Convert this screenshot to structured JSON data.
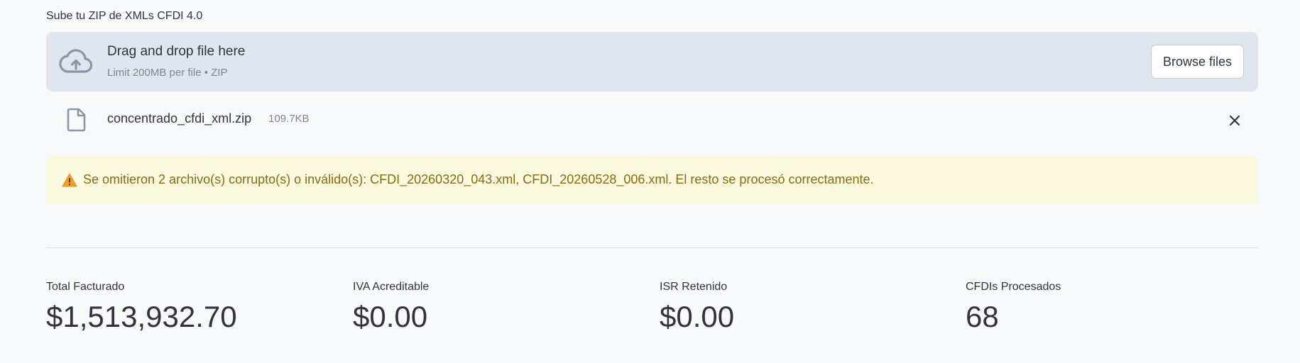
{
  "uploader": {
    "label": "Sube tu ZIP de XMLs CFDI 4.0",
    "drop_title": "Drag and drop file here",
    "drop_subtitle": "Limit 200MB per file • ZIP",
    "browse_label": "Browse files",
    "icon": "cloud-upload-icon"
  },
  "uploaded_file": {
    "name": "concentrado_cfdi_xml.zip",
    "size": "109.7KB",
    "icon": "file-icon",
    "remove_icon": "close-icon"
  },
  "alert": {
    "icon": "warning-icon",
    "text": "Se omitieron 2 archivo(s) corrupto(s) o inválido(s): CFDI_20260320_043.xml, CFDI_20260528_006.xml. El resto se procesó correctamente.",
    "color": "#8a6b0f",
    "background": "#fbf9de"
  },
  "metrics": [
    {
      "label": "Total Facturado",
      "value": "$1,513,932.70"
    },
    {
      "label": "IVA Acreditable",
      "value": "$0.00"
    },
    {
      "label": "ISR Retenido",
      "value": "$0.00"
    },
    {
      "label": "CFDIs Procesados",
      "value": "68"
    }
  ]
}
